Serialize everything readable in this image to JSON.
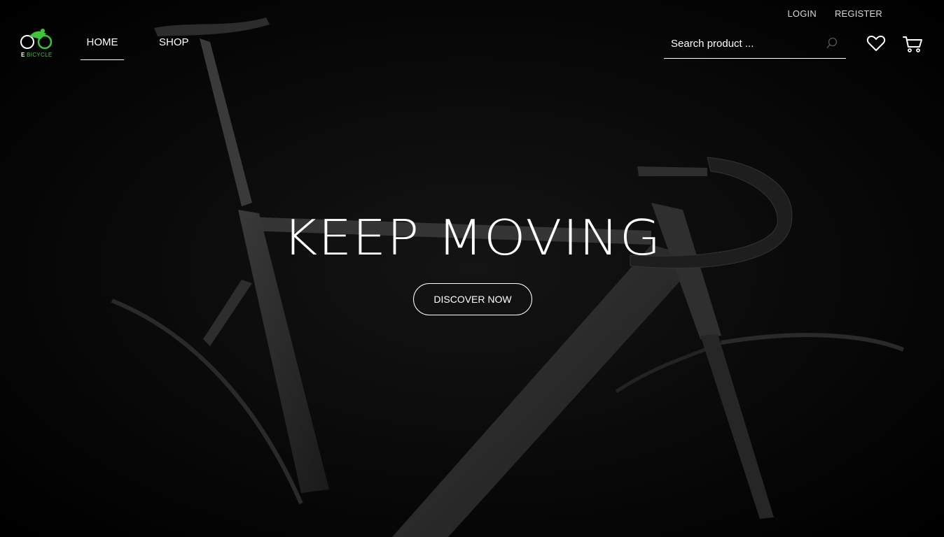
{
  "brand": {
    "logo_prefix": "E",
    "logo_name": "BICYCLE",
    "accent_color": "#3ec63a"
  },
  "top_links": {
    "login": "LOGIN",
    "register": "REGISTER"
  },
  "nav": {
    "home": "HOME",
    "shop": "SHOP",
    "active": "HOME"
  },
  "search": {
    "placeholder": "Search product ...",
    "value": ""
  },
  "icons": {
    "search": "search-icon",
    "wishlist": "heart-icon",
    "cart": "cart-icon"
  },
  "hero": {
    "headline": "KEEP MOVING",
    "cta_label": "DISCOVER NOW",
    "background": "dark road bicycle photo"
  }
}
